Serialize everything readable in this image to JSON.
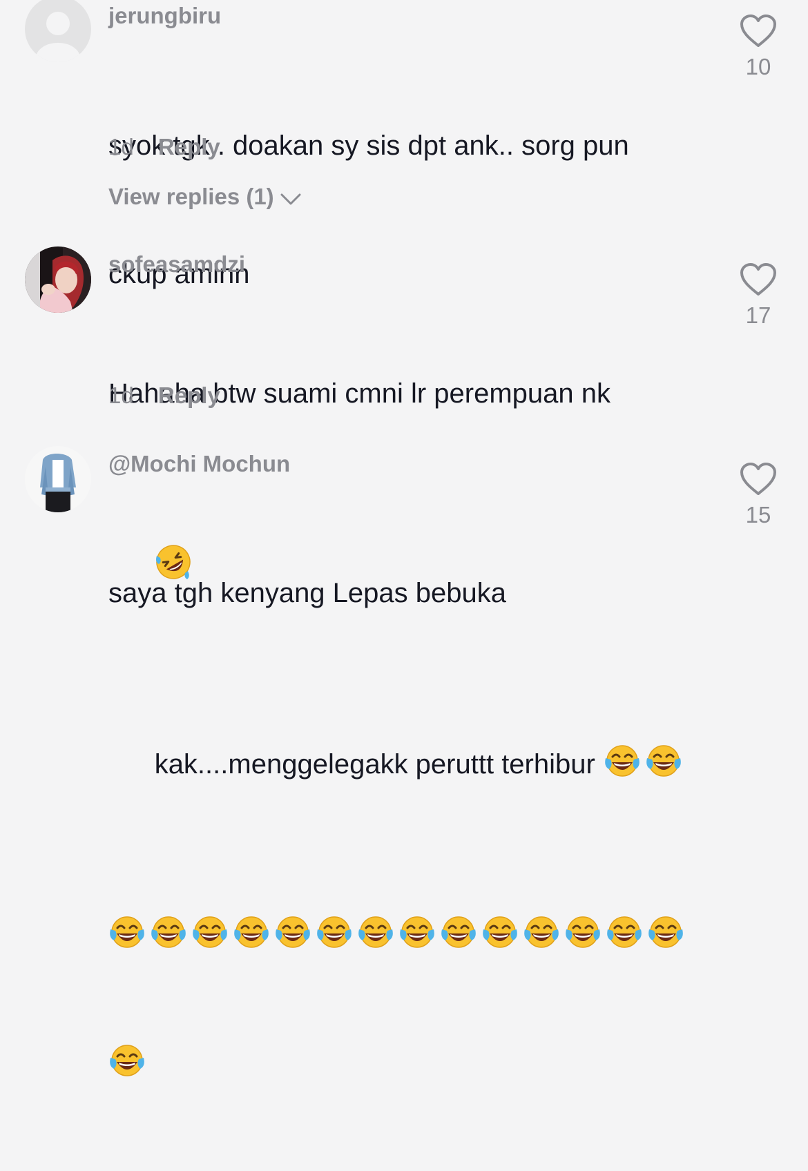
{
  "comments": [
    {
      "username": "jerungbiru",
      "text_lines": [
        "syok tgk.. doakan sy sis dpt ank.. sorg pun",
        "ckup aminn"
      ],
      "time": "1d",
      "reply_label": "Reply",
      "view_replies": "View replies (1)",
      "likes": "10",
      "avatar": "default-avatar-icon"
    },
    {
      "username": "sofeasamdzi",
      "text_lines": [
        "Hahaha btw suami cmni lr perempuan nk"
      ],
      "emoji_line": [
        "rolling-on-floor-laughing-emoji"
      ],
      "time": "1d",
      "reply_label": "Reply",
      "likes": "17",
      "avatar": "profile-photo-avatar"
    },
    {
      "username": "@Mochi Mochun",
      "text_lines": [
        "saya tgh kenyang Lepas bebuka",
        "kak....menggelegakk peruttt terhibur"
      ],
      "emoji_count_line2": 2,
      "emoji_count_line3": 14,
      "emoji_count_line4": 1,
      "emoji_name": "face-with-tears-of-joy-emoji",
      "likes": "15",
      "avatar": "profile-photo-avatar"
    }
  ]
}
